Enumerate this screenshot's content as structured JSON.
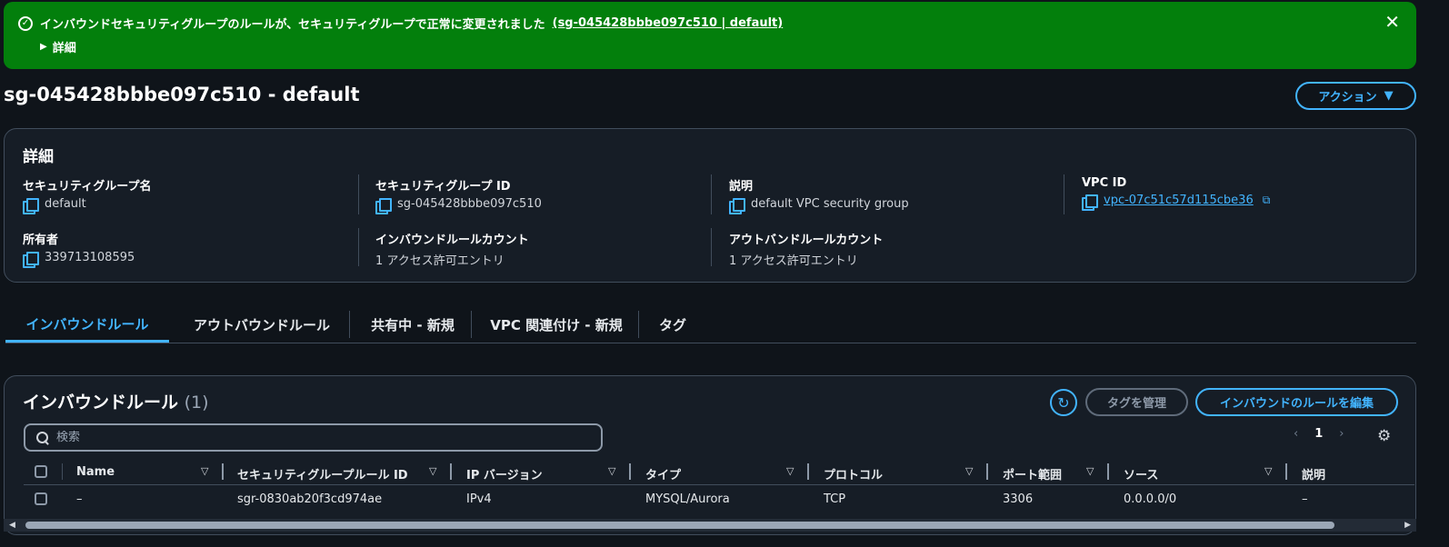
{
  "flash": {
    "message": "インバウンドセキュリティグループのルールが、セキュリティグループで正常に変更されました",
    "link": "(sg-045428bbbe097c510 | default)",
    "details_label": "詳細"
  },
  "page": {
    "title": "sg-045428bbbe097c510 - default",
    "actions_label": "アクション"
  },
  "details": {
    "heading": "詳細",
    "fields": [
      {
        "label": "セキュリティグループ名",
        "value": "default"
      },
      {
        "label": "セキュリティグループ ID",
        "value": "sg-045428bbbe097c510"
      },
      {
        "label": "説明",
        "value": "default VPC security group"
      },
      {
        "label": "VPC ID",
        "value": "vpc-07c51c57d115cbe36"
      },
      {
        "label": "所有者",
        "value": "339713108595"
      },
      {
        "label": "インバウンドルールカウント",
        "value": "1 アクセス許可エントリ"
      },
      {
        "label": "アウトバンドルールカウント",
        "value": "1 アクセス許可エントリ"
      }
    ]
  },
  "tabs": [
    {
      "label": "インバウンドルール",
      "active": true
    },
    {
      "label": "アウトバウンドルール"
    },
    {
      "label": "共有中 - 新規"
    },
    {
      "label": "VPC 関連付け - 新規"
    },
    {
      "label": "タグ"
    }
  ],
  "rules": {
    "heading": "インバウンドルール",
    "count": "(1)",
    "manage_tags_label": "タグを管理",
    "edit_label": "インバウンドのルールを編集",
    "search_placeholder": "検索",
    "page_number": "1",
    "columns": [
      "Name",
      "セキュリティグループルール ID",
      "IP バージョン",
      "タイプ",
      "プロトコル",
      "ポート範囲",
      "ソース",
      "説明"
    ],
    "rows": [
      [
        "–",
        "sgr-0830ab20f3cd974ae",
        "IPv4",
        "MYSQL/Aurora",
        "TCP",
        "3306",
        "0.0.0.0/0",
        "–"
      ]
    ]
  },
  "colors": {
    "success": "#037f0c",
    "accent": "#42b4ff",
    "background": "#0f141a",
    "panel": "#161d26"
  }
}
